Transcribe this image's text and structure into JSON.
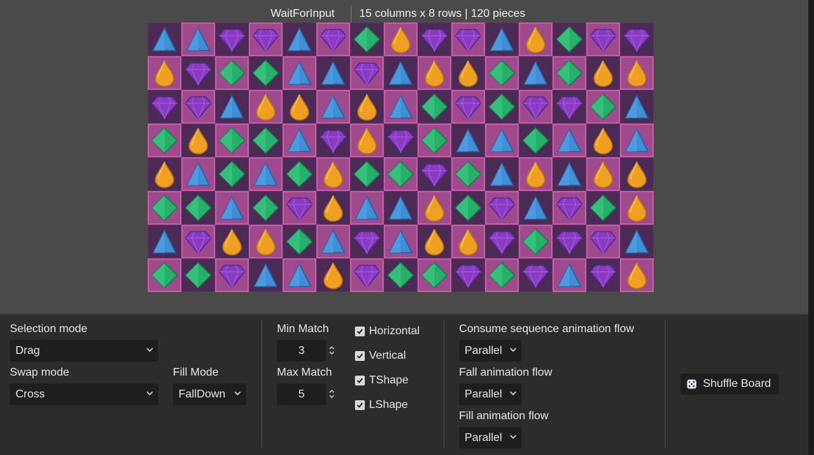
{
  "status": {
    "state": "WaitForInput",
    "info": "15 columns x 8 rows | 120 pieces"
  },
  "board": {
    "columns": 15,
    "rows": 8,
    "pieces": [
      [
        "tri",
        "tri",
        "gem",
        "gem",
        "tri",
        "gem",
        "dia",
        "drop",
        "gem",
        "gem",
        "tri",
        "drop",
        "dia",
        "gem",
        "gem"
      ],
      [
        "drop",
        "gem",
        "dia",
        "dia",
        "tri",
        "tri",
        "gem",
        "tri",
        "drop",
        "drop",
        "dia",
        "tri",
        "dia",
        "drop",
        "drop"
      ],
      [
        "gem",
        "gem",
        "tri",
        "drop",
        "drop",
        "tri",
        "drop",
        "tri",
        "dia",
        "gem",
        "dia",
        "gem",
        "gem",
        "dia",
        "tri"
      ],
      [
        "dia",
        "drop",
        "dia",
        "dia",
        "tri",
        "gem",
        "drop",
        "gem",
        "dia",
        "tri",
        "tri",
        "dia",
        "tri",
        "drop",
        "tri"
      ],
      [
        "drop",
        "tri",
        "dia",
        "tri",
        "dia",
        "drop",
        "dia",
        "dia",
        "gem",
        "dia",
        "tri",
        "drop",
        "tri",
        "drop",
        "drop"
      ],
      [
        "dia",
        "dia",
        "tri",
        "dia",
        "gem",
        "drop",
        "tri",
        "tri",
        "drop",
        "dia",
        "gem",
        "tri",
        "gem",
        "dia",
        "drop"
      ],
      [
        "tri",
        "gem",
        "drop",
        "drop",
        "dia",
        "tri",
        "gem",
        "tri",
        "drop",
        "drop",
        "gem",
        "dia",
        "gem",
        "gem",
        "tri"
      ],
      [
        "dia",
        "dia",
        "gem",
        "tri",
        "tri",
        "drop",
        "gem",
        "dia",
        "dia",
        "gem",
        "dia",
        "gem",
        "tri",
        "gem",
        "drop"
      ]
    ],
    "colors": {
      "tri": "#3f8fd8",
      "gem": "#8a3bc4",
      "dia": "#27b06a",
      "drop": "#f0a020",
      "cell_dark": "#4c2a56",
      "cell_light": "#9e4a8c"
    }
  },
  "controls": {
    "selection_mode": {
      "label": "Selection mode",
      "value": "Drag"
    },
    "swap_mode": {
      "label": "Swap mode",
      "value": "Cross"
    },
    "fill_mode": {
      "label": "Fill Mode",
      "value": "FallDown"
    },
    "min_match": {
      "label": "Min Match",
      "value": "3"
    },
    "max_match": {
      "label": "Max Match",
      "value": "5"
    },
    "shapes": [
      {
        "label": "Horizontal",
        "checked": true
      },
      {
        "label": "Vertical",
        "checked": true
      },
      {
        "label": "TShape",
        "checked": true
      },
      {
        "label": "LShape",
        "checked": true
      }
    ],
    "consume_flow": {
      "label": "Consume sequence animation flow",
      "value": "Parallel"
    },
    "fall_flow": {
      "label": "Fall animation flow",
      "value": "Parallel"
    },
    "fill_flow": {
      "label": "Fill animation flow",
      "value": "Parallel"
    },
    "shuffle": {
      "label": "Shuffle Board",
      "icon": "dice-icon"
    }
  }
}
